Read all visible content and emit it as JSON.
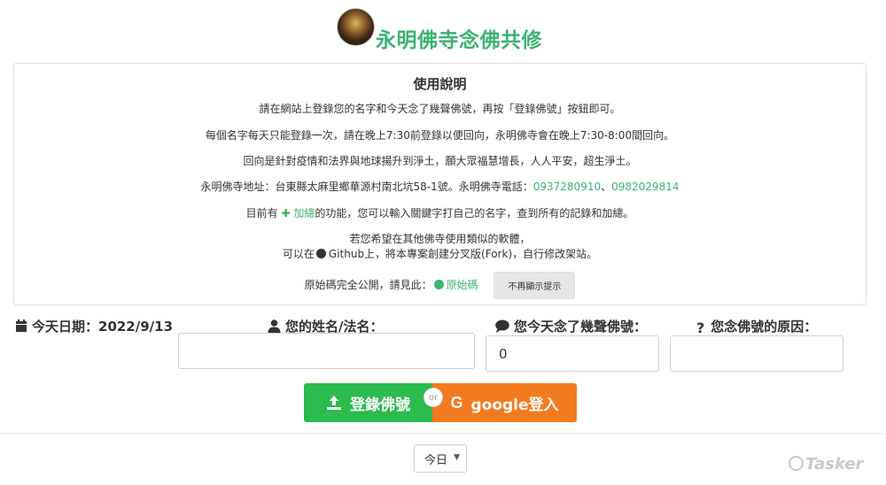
{
  "header": {
    "avatar_icon": "buddha-avatar",
    "title": "永明佛寺念佛共修"
  },
  "instructions": {
    "heading": "使用說明",
    "line1": "請在網站上登錄您的名字和今天念了幾聲佛號，再按「登錄佛號」按鈕即可。",
    "line2": "每個名字每天只能登錄一次，請在晚上7:30前登錄以便回向，永明佛寺會在晚上7:30-8:00間回向。",
    "line3": "回向是針對疫情和法界與地球揚升到淨土，願大眾福慧增長，人人平安，超生淨土。",
    "line4_prefix": "永明佛寺地址：台東縣太麻里鄉華源村南北坑58-1號。永明佛寺電話：",
    "phone1": "0937280910",
    "phone_sep": "、",
    "phone2": "0982029814",
    "line5_prefix": "目前有",
    "line5_link": "加總",
    "line5_suffix": "的功能，您可以輸入關鍵字打自己的名字，查到所有的記錄和加總。",
    "line6": "若您希望在其他佛寺使用類似的軟體，",
    "line7_prefix": "可以在",
    "line7_mid": "Github上，將本專案創建分叉版(Fork)，自行修改架站。",
    "line8_prefix": "原始碼完全公開，請見此：",
    "line8_link": "原始碼",
    "dismiss_label": "不再顯示提示"
  },
  "form": {
    "date_label": "今天日期：2022/9/13",
    "name_label": "您的姓名/法名：",
    "name_value": "",
    "count_label": "您今天念了幾聲佛號：",
    "count_value": "0",
    "reason_label": "您念佛號的原因：",
    "reason_value": ""
  },
  "actions": {
    "register_label": "登錄佛號",
    "or_label": "or",
    "google_label": "google登入"
  },
  "filter": {
    "selected": "今日"
  },
  "watermark": "Tasker",
  "colors": {
    "accent": "#3cb371",
    "register_btn": "#2bbb4e",
    "google_btn": "#f47a1f"
  }
}
